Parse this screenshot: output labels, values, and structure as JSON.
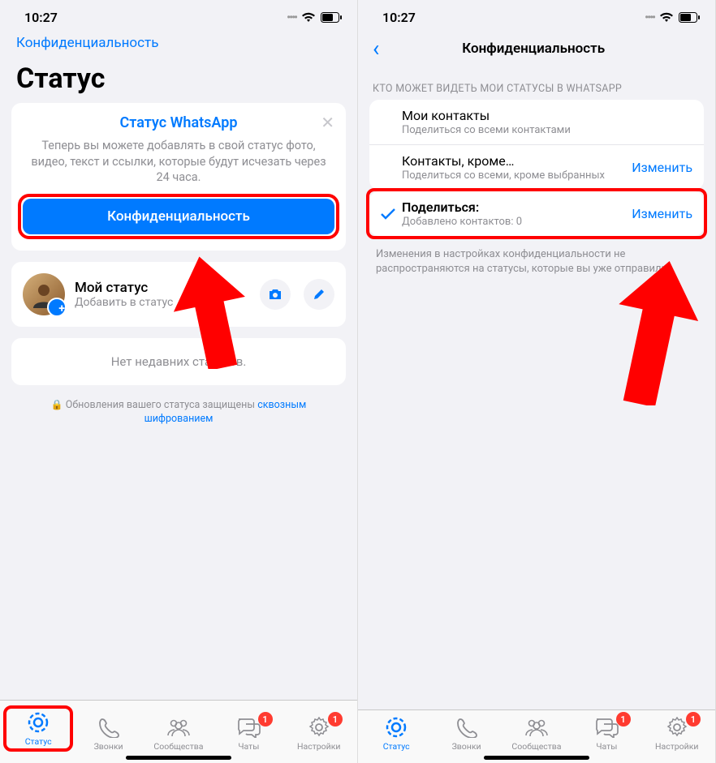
{
  "status_bar": {
    "time": "10:27"
  },
  "left": {
    "nav_link": "Конфиденциальность",
    "title": "Статус",
    "promo": {
      "heading": "Статус WhatsApp",
      "desc": "Теперь вы можете добавлять в свой статус фото, видео, текст и ссылки, которые будут исчезать через 24 часа.",
      "button": "Конфиденциальность"
    },
    "my_status": {
      "title": "Мой статус",
      "subtitle": "Добавить в статус"
    },
    "empty": "Нет недавних статусов.",
    "footer_note_pre": "Обновления вашего статуса защищены ",
    "footer_note_link": "сквозным шифрованием"
  },
  "right": {
    "title": "Конфиденциальность",
    "section_header": "КТО МОЖЕТ ВИДЕТЬ МОИ СТАТУСЫ В WHATSAPP",
    "rows": [
      {
        "title": "Мои контакты",
        "subtitle": "Поделиться со всеми контактами",
        "action": ""
      },
      {
        "title": "Контакты, кроме…",
        "subtitle": "Поделиться со всеми, кроме выбранных",
        "action": "Изменить"
      },
      {
        "title": "Поделиться:",
        "subtitle": "Добавлено контактов: 0",
        "action": "Изменить",
        "checked": true
      }
    ],
    "info_footer": "Изменения в настройках конфиденциальности не распространяются на статусы, которые вы уже отправили."
  },
  "tabs": {
    "t0": "Статус",
    "t1": "Звонки",
    "t2": "Сообщества",
    "t3": "Чаты",
    "t4": "Настройки",
    "badge3": "1",
    "badge4": "1"
  }
}
